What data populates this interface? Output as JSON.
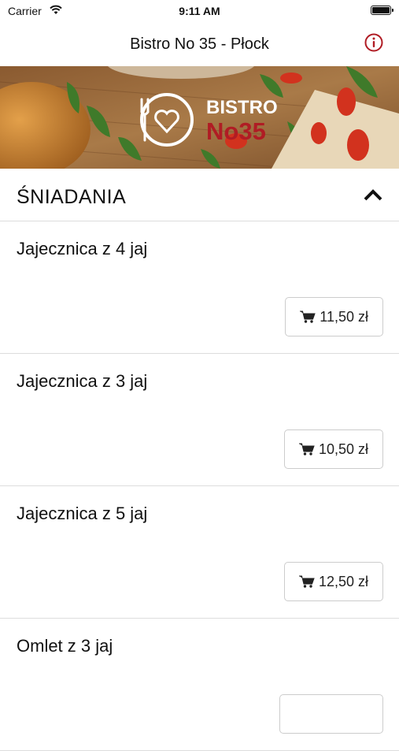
{
  "status_bar": {
    "carrier": "Carrier",
    "time": "9:11 AM"
  },
  "nav": {
    "title": "Bistro No 35 - Płock",
    "info_icon": "info-icon"
  },
  "banner": {
    "logo_text_top": "BISTRO",
    "logo_text_bottom": "No35"
  },
  "colors": {
    "accent": "#b01c24",
    "border": "#dddddd"
  },
  "section": {
    "title": "ŚNIADANIA",
    "expanded": true
  },
  "items": [
    {
      "name": "Jajecznica z 4 jaj",
      "price": "11,50 zł"
    },
    {
      "name": "Jajecznica z 3 jaj",
      "price": "10,50 zł"
    },
    {
      "name": "Jajecznica z 5 jaj",
      "price": "12,50 zł"
    },
    {
      "name": "Omlet z 3 jaj",
      "price": ""
    }
  ]
}
